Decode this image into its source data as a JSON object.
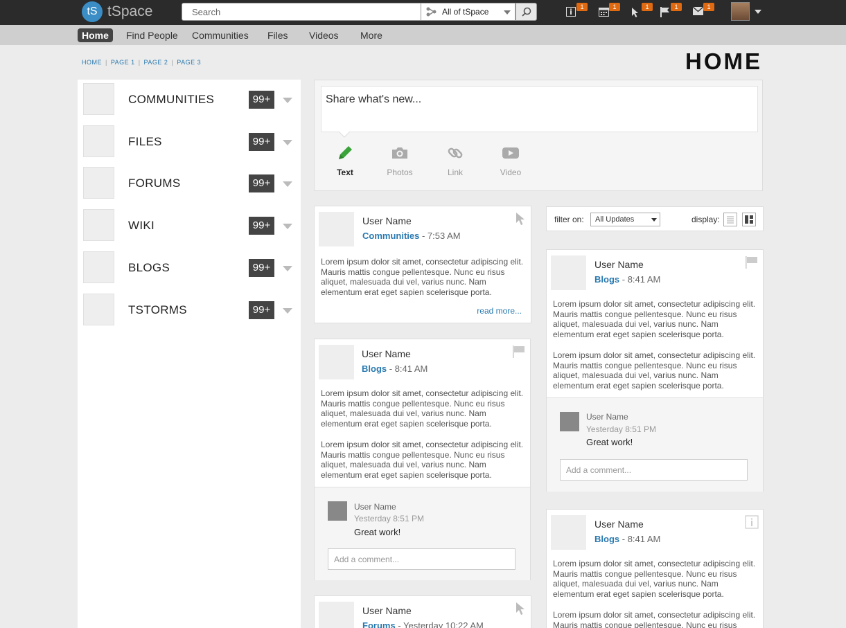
{
  "app": {
    "logo_initials": "tS",
    "name": "tSpace"
  },
  "search": {
    "placeholder": "Search",
    "scope": "All of tSpace"
  },
  "notifications": [
    {
      "icon": "info-icon",
      "count": "1"
    },
    {
      "icon": "calendar-icon",
      "count": "1"
    },
    {
      "icon": "cursor-icon",
      "count": "1"
    },
    {
      "icon": "flag-icon",
      "count": "1"
    },
    {
      "icon": "mail-icon",
      "count": "1"
    }
  ],
  "nav": {
    "items": [
      "Home",
      "Find People",
      "Communities",
      "Files",
      "Videos",
      "More"
    ]
  },
  "breadcrumb": [
    "HOME",
    "PAGE 1",
    "PAGE 2",
    "PAGE 3"
  ],
  "page_title": "HOME",
  "sidebar": {
    "items": [
      {
        "label": "COMMUNITIES",
        "count": "99+"
      },
      {
        "label": "FILES",
        "count": "99+"
      },
      {
        "label": "FORUMS",
        "count": "99+"
      },
      {
        "label": "WIKI",
        "count": "99+"
      },
      {
        "label": "BLOGS",
        "count": "99+"
      },
      {
        "label": "TSTORMS",
        "count": "99+"
      }
    ]
  },
  "share": {
    "placeholder": "Share what's new...",
    "options": [
      "Text",
      "Photos",
      "Link",
      "Video"
    ]
  },
  "filter": {
    "label": "filter on:",
    "selected": "All Updates",
    "display_label": "display:"
  },
  "colors": {
    "accent": "#2a7ab0",
    "badge": "#e06a12",
    "active_green": "#3aa43a"
  },
  "lorem": "Lorem ipsum dolor sit amet, consectetur adipiscing elit. Mauris mattis congue pellentesque. Nunc eu risus aliquet, malesuada dui vel, varius nunc. Nam elementum erat eget sapien scelerisque porta.",
  "cards": [
    {
      "user": "User Name",
      "source": "Communities",
      "time": "- 7:53 AM",
      "icon": "cursor-icon",
      "read_more": "read more..."
    },
    {
      "user": "User Name",
      "source": "Blogs",
      "time": "- 8:41 AM",
      "icon": "flag-icon",
      "comment": {
        "user": "User Name",
        "time": "Yesterday 8:51 PM",
        "text": "Great work!",
        "placeholder": "Add a comment..."
      }
    },
    {
      "user": "User Name",
      "source": "Forums",
      "time": "- Yesterday 10:22 AM",
      "icon": "cursor-icon"
    },
    {
      "user": "User Name",
      "source": "Blogs",
      "time": "- 8:41 AM",
      "icon": "flag-icon",
      "comment": {
        "user": "User Name",
        "time": "Yesterday 8:51 PM",
        "text": "Great work!",
        "placeholder": "Add a comment..."
      }
    },
    {
      "user": "User Name",
      "source": "Blogs",
      "time": "- 8:41 AM",
      "icon": "info-icon"
    }
  ]
}
